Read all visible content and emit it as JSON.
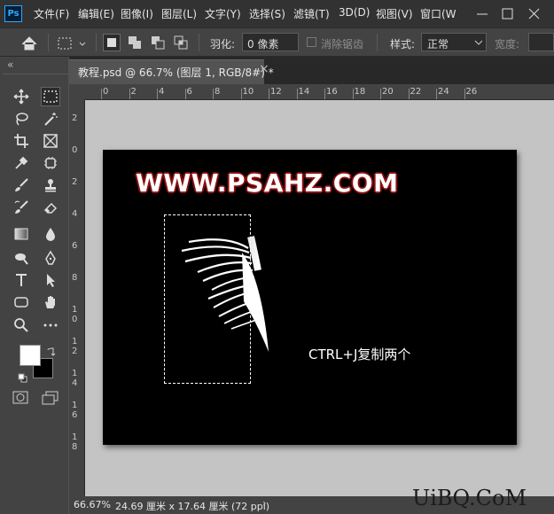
{
  "app": {
    "logo_text": "Ps"
  },
  "menubar": {
    "items": [
      "文件(F)",
      "编辑(E)",
      "图像(I)",
      "图层(L)",
      "文字(Y)",
      "选择(S)",
      "滤镜(T)",
      "3D(D)",
      "视图(V)",
      "窗口(W"
    ]
  },
  "options_bar": {
    "feather_label": "羽化:",
    "feather_value": "0 像素",
    "antialias_label": "消除锯齿",
    "style_label": "样式:",
    "style_value": "正常",
    "width_label": "宽度:"
  },
  "toolbar": {
    "collapse_glyph": "«",
    "tools": [
      "move-icon",
      "marquee-icon",
      "lasso-icon",
      "magic-wand-icon",
      "crop-icon",
      "frame-icon",
      "eyedropper-icon",
      "spot-healing-icon",
      "brush-icon",
      "stamp-icon",
      "history-brush-icon",
      "eraser-icon",
      "gradient-icon",
      "blur-icon",
      "dodge-icon",
      "pen-icon",
      "type-icon",
      "path-select-icon",
      "shape-icon",
      "hand-icon",
      "zoom-icon",
      "more-icon"
    ],
    "foreground_color": "#ffffff",
    "background_color": "#000000"
  },
  "document": {
    "tab_label": "教程.psd @ 66.7% (图层 1, RGB/8#) *",
    "tab_close": "×",
    "ruler_top": [
      "0",
      "2",
      "4",
      "6",
      "8",
      "10",
      "12",
      "14",
      "16",
      "18",
      "20",
      "22",
      "24",
      "26"
    ],
    "ruler_left": [
      "2",
      "0",
      "2",
      "4",
      "6",
      "8",
      "1\n0",
      "1\n2",
      "1\n4",
      "1\n6",
      "1\n8"
    ],
    "canvas_title": "WWW.PSAHZ.COM",
    "canvas_caption": "CTRL+J复制两个"
  },
  "statusbar": {
    "zoom": "66.67%",
    "doc_size": "24.69 厘米 x 17.64 厘米 (72 ppi)",
    "arrow": "›"
  },
  "site_logo": "UiBQ.CoM",
  "colors": {
    "accent": "#31a8ff",
    "title_stroke": "#8a1010"
  }
}
